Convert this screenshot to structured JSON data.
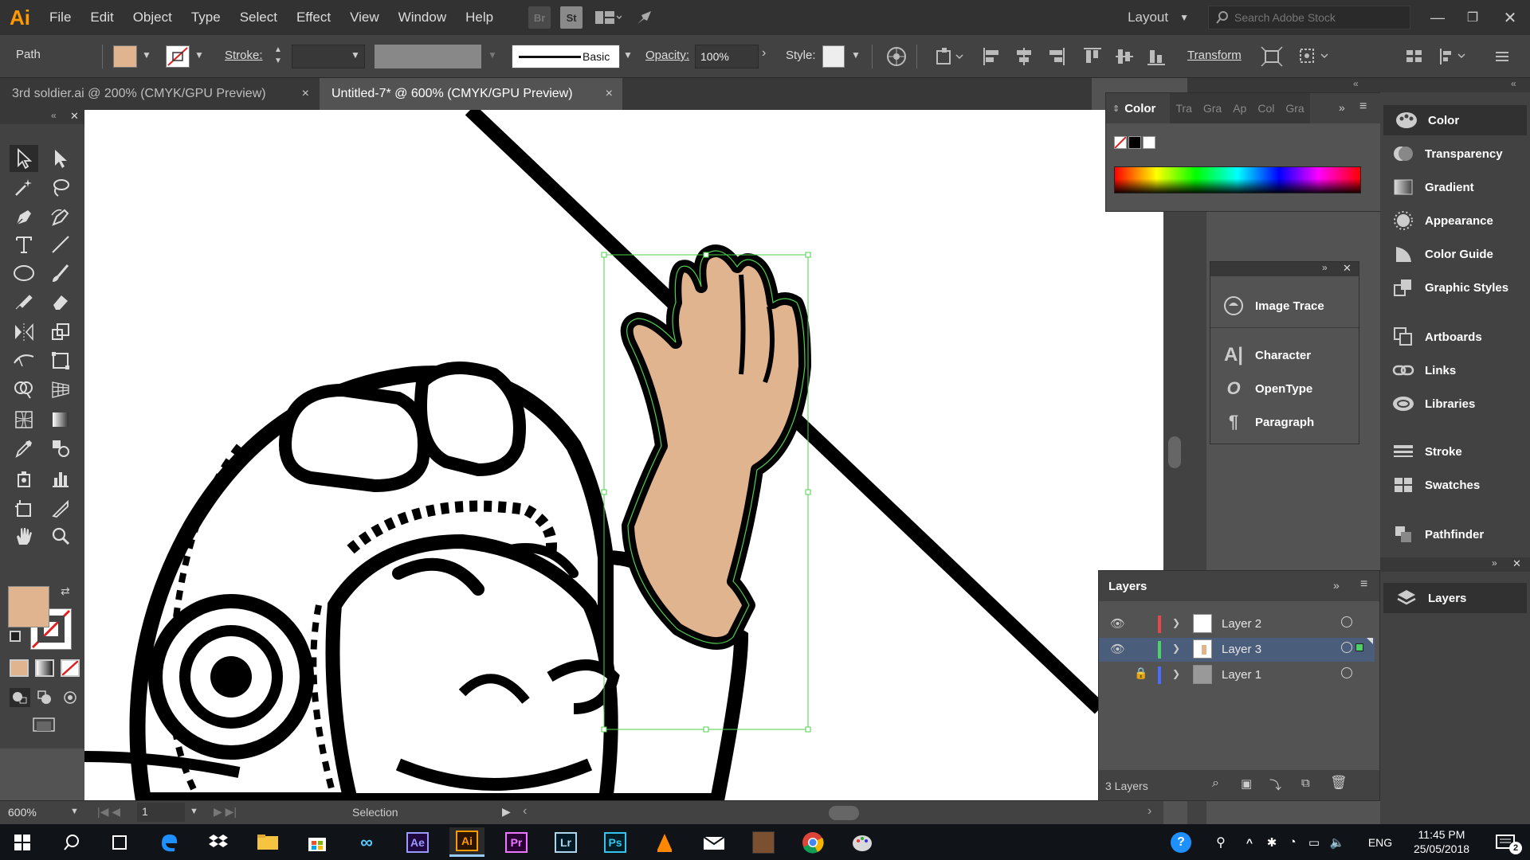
{
  "app": {
    "logo": "Ai",
    "layout_label": "Layout",
    "stock_search_placeholder": "Search Adobe Stock"
  },
  "menu": [
    "File",
    "Edit",
    "Object",
    "Type",
    "Select",
    "Effect",
    "View",
    "Window",
    "Help"
  ],
  "menu_icons": {
    "bridge": "Br",
    "stock": "St"
  },
  "control": {
    "selection_type": "Path",
    "fill_color": "#e0b48f",
    "stroke_label": "Stroke:",
    "brush_label": "Basic",
    "opacity_label": "Opacity:",
    "opacity_value": "100%",
    "style_label": "Style:",
    "transform_label": "Transform"
  },
  "tabs": [
    {
      "label": "3rd soldier.ai @ 200% (CMYK/GPU Preview)",
      "close": "×"
    },
    {
      "label": "Untitled-7* @ 600% (CMYK/GPU Preview)",
      "close": "×"
    }
  ],
  "status": {
    "zoom": "600%",
    "artboard": "1",
    "tool": "Selection"
  },
  "color_panel": {
    "title": "Color",
    "tabs": [
      "Tra",
      "Gra",
      "Ap",
      "Col",
      "Gra"
    ]
  },
  "float_panel": {
    "items": [
      "Image Trace",
      "Character",
      "OpenType",
      "Paragraph"
    ]
  },
  "layers_panel": {
    "title": "Layers",
    "layers": [
      {
        "name": "Layer 2",
        "color": "#e8474a",
        "visible": true,
        "locked": false,
        "selected": false
      },
      {
        "name": "Layer 3",
        "color": "#4fd06a",
        "visible": true,
        "locked": false,
        "selected": true
      },
      {
        "name": "Layer 1",
        "color": "#4a6bff",
        "visible": false,
        "locked": true,
        "selected": false
      }
    ],
    "count_label": "3 Layers"
  },
  "dock": {
    "group1": [
      "Color",
      "Transparency",
      "Gradient",
      "Appearance",
      "Color Guide",
      "Graphic Styles"
    ],
    "group2": [
      "Artboards",
      "Links",
      "Libraries"
    ],
    "group3": [
      "Stroke",
      "Swatches"
    ],
    "group4": [
      "Pathfinder"
    ],
    "group5": [
      "Layers"
    ]
  },
  "taskbar": {
    "time": "11:45 PM",
    "date": "25/05/2018",
    "lang": "ENG",
    "notif_count": "2",
    "apps": [
      "Ae",
      "Ai",
      "Pr",
      "Lr",
      "Ps"
    ]
  }
}
